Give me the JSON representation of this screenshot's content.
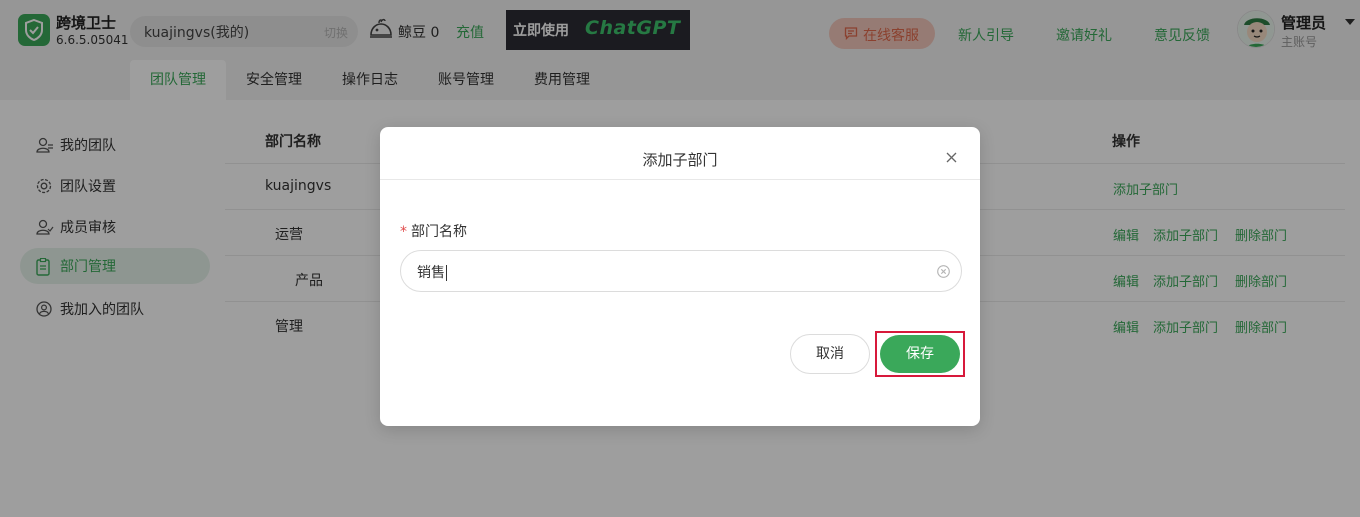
{
  "app": {
    "name": "跨境卫士",
    "version": "6.6.5.05041"
  },
  "account": {
    "name": "kuajingvs(我的)",
    "switch_label": "切换"
  },
  "beans": {
    "label": "鲸豆",
    "value": "0",
    "recharge_label": "充值"
  },
  "banner": {
    "text_cn": "立即使用",
    "text_en": "ChatGPT"
  },
  "header": {
    "service_label": "在线客服",
    "links": [
      "新人引导",
      "邀请好礼",
      "意见反馈"
    ],
    "user_name": "管理员",
    "user_sub": "主账号"
  },
  "tabs": [
    "团队管理",
    "安全管理",
    "操作日志",
    "账号管理",
    "费用管理"
  ],
  "sidebar": {
    "items": [
      {
        "label": "我的团队",
        "icon": "user-icon"
      },
      {
        "label": "团队设置",
        "icon": "settings-icon"
      },
      {
        "label": "成员审核",
        "icon": "user-check-icon"
      },
      {
        "label": "部门管理",
        "icon": "clipboard-icon"
      },
      {
        "label": "我加入的团队",
        "icon": "person-circle-icon"
      }
    ]
  },
  "table": {
    "columns": [
      "部门名称",
      "操作"
    ],
    "rows": [
      {
        "name": "kuajingvs",
        "ops": [
          "添加子部门"
        ]
      },
      {
        "name": "运营",
        "ops": [
          "编辑",
          "添加子部门",
          "删除部门"
        ]
      },
      {
        "name": "产品",
        "ops": [
          "编辑",
          "添加子部门",
          "删除部门"
        ]
      },
      {
        "name": "管理",
        "ops": [
          "编辑",
          "添加子部门",
          "删除部门"
        ]
      }
    ]
  },
  "modal": {
    "title": "添加子部门",
    "field_label": "部门名称",
    "required_mark": "*",
    "field_value": "销售",
    "cancel_label": "取消",
    "save_label": "保存"
  },
  "colors": {
    "accent": "#3aa85a",
    "highlight": "#d7193b",
    "service_bg": "#f3c7bc"
  }
}
